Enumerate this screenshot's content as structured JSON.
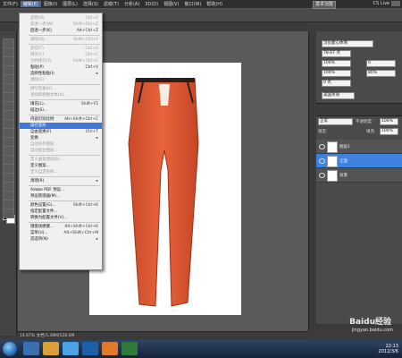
{
  "menubar": {
    "items": [
      "文件(F)",
      "编辑(E)",
      "图像(I)",
      "图层(L)",
      "选择(S)",
      "滤镜(T)",
      "分析(A)",
      "3D(D)",
      "视图(V)",
      "窗口(W)",
      "帮助(H)"
    ],
    "active_index": 1,
    "workspace_badge": "基本功能",
    "cs_live": "CS Live"
  },
  "edit_menu": [
    {
      "label": "还原(O)",
      "shortcut": "Ctrl+Z",
      "disabled": true
    },
    {
      "label": "前进一步(W)",
      "shortcut": "Shift+Ctrl+Z",
      "disabled": true
    },
    {
      "label": "后退一步(K)",
      "shortcut": "Alt+Ctrl+Z",
      "disabled": false
    },
    {
      "sep": true
    },
    {
      "label": "渐隐(D)...",
      "shortcut": "Shift+Ctrl+F",
      "disabled": true
    },
    {
      "sep": true
    },
    {
      "label": "剪切(T)",
      "shortcut": "Ctrl+X",
      "disabled": true
    },
    {
      "label": "拷贝(C)",
      "shortcut": "Ctrl+C",
      "disabled": true
    },
    {
      "label": "合并拷贝(Y)",
      "shortcut": "Shift+Ctrl+C",
      "disabled": true
    },
    {
      "label": "粘贴(P)",
      "shortcut": "Ctrl+V",
      "disabled": false
    },
    {
      "label": "选择性粘贴(I)",
      "shortcut": "▸",
      "disabled": false
    },
    {
      "label": "清除(E)",
      "shortcut": "",
      "disabled": true
    },
    {
      "sep": true
    },
    {
      "label": "拼写检查(H)...",
      "shortcut": "",
      "disabled": true
    },
    {
      "label": "查找和替换文本(X)...",
      "shortcut": "",
      "disabled": true
    },
    {
      "sep": true
    },
    {
      "label": "填充(L)...",
      "shortcut": "Shift+F5",
      "disabled": false
    },
    {
      "label": "描边(S)...",
      "shortcut": "",
      "disabled": false
    },
    {
      "sep": true
    },
    {
      "label": "内容识别比例",
      "shortcut": "Alt+Shift+Ctrl+C",
      "disabled": false
    },
    {
      "label": "操控变形",
      "shortcut": "",
      "disabled": false,
      "highlight": true
    },
    {
      "label": "自由变换(F)",
      "shortcut": "Ctrl+T",
      "disabled": false
    },
    {
      "label": "变换",
      "shortcut": "▸",
      "disabled": false
    },
    {
      "label": "自动对齐图层...",
      "shortcut": "",
      "disabled": true
    },
    {
      "label": "自动混合图层...",
      "shortcut": "",
      "disabled": true
    },
    {
      "sep": true
    },
    {
      "label": "定义画笔预设(B)...",
      "shortcut": "",
      "disabled": true
    },
    {
      "label": "定义图案...",
      "shortcut": "",
      "disabled": false
    },
    {
      "label": "定义自定形状...",
      "shortcut": "",
      "disabled": true
    },
    {
      "sep": true
    },
    {
      "label": "清理(R)",
      "shortcut": "▸",
      "disabled": false
    },
    {
      "sep": true
    },
    {
      "label": "Adobe PDF 预设...",
      "shortcut": "",
      "disabled": false
    },
    {
      "label": "预设管理器(M)...",
      "shortcut": "",
      "disabled": false
    },
    {
      "sep": true
    },
    {
      "label": "颜色设置(G)...",
      "shortcut": "Shift+Ctrl+K",
      "disabled": false
    },
    {
      "label": "指定配置文件...",
      "shortcut": "",
      "disabled": false
    },
    {
      "label": "转换为配置文件(V)...",
      "shortcut": "",
      "disabled": false
    },
    {
      "sep": true
    },
    {
      "label": "键盘快捷键...",
      "shortcut": "Alt+Shift+Ctrl+K",
      "disabled": false
    },
    {
      "label": "菜单(U)...",
      "shortcut": "Alt+Shift+Ctrl+M",
      "disabled": false
    },
    {
      "label": "首选项(N)",
      "shortcut": "▸",
      "disabled": false
    }
  ],
  "char_panel": {
    "font_family": "汉仪菱心体简",
    "font_size": "78.67 点",
    "leading": "100%",
    "tracking": "0",
    "scale_v": "100%",
    "scale_h": "80%",
    "baseline": "0 点",
    "language": "美国英语"
  },
  "layers_panel": {
    "blend_mode": "正常",
    "opacity_label": "不透明度:",
    "opacity": "100%",
    "lock_label": "锁定:",
    "fill_label": "填充:",
    "fill": "100%",
    "layers": [
      {
        "name": "图层1",
        "selected": false
      },
      {
        "name": "正面",
        "selected": true
      },
      {
        "name": "背景",
        "selected": false
      }
    ]
  },
  "status": {
    "zoom": "14.67%",
    "doc": "文档:5.49M/128.0M"
  },
  "taskbar": {
    "time": "22:13",
    "date": "2012/3/6"
  },
  "watermark": {
    "line1": "Baidu经验",
    "line2": "jingyan.baidu.com"
  }
}
